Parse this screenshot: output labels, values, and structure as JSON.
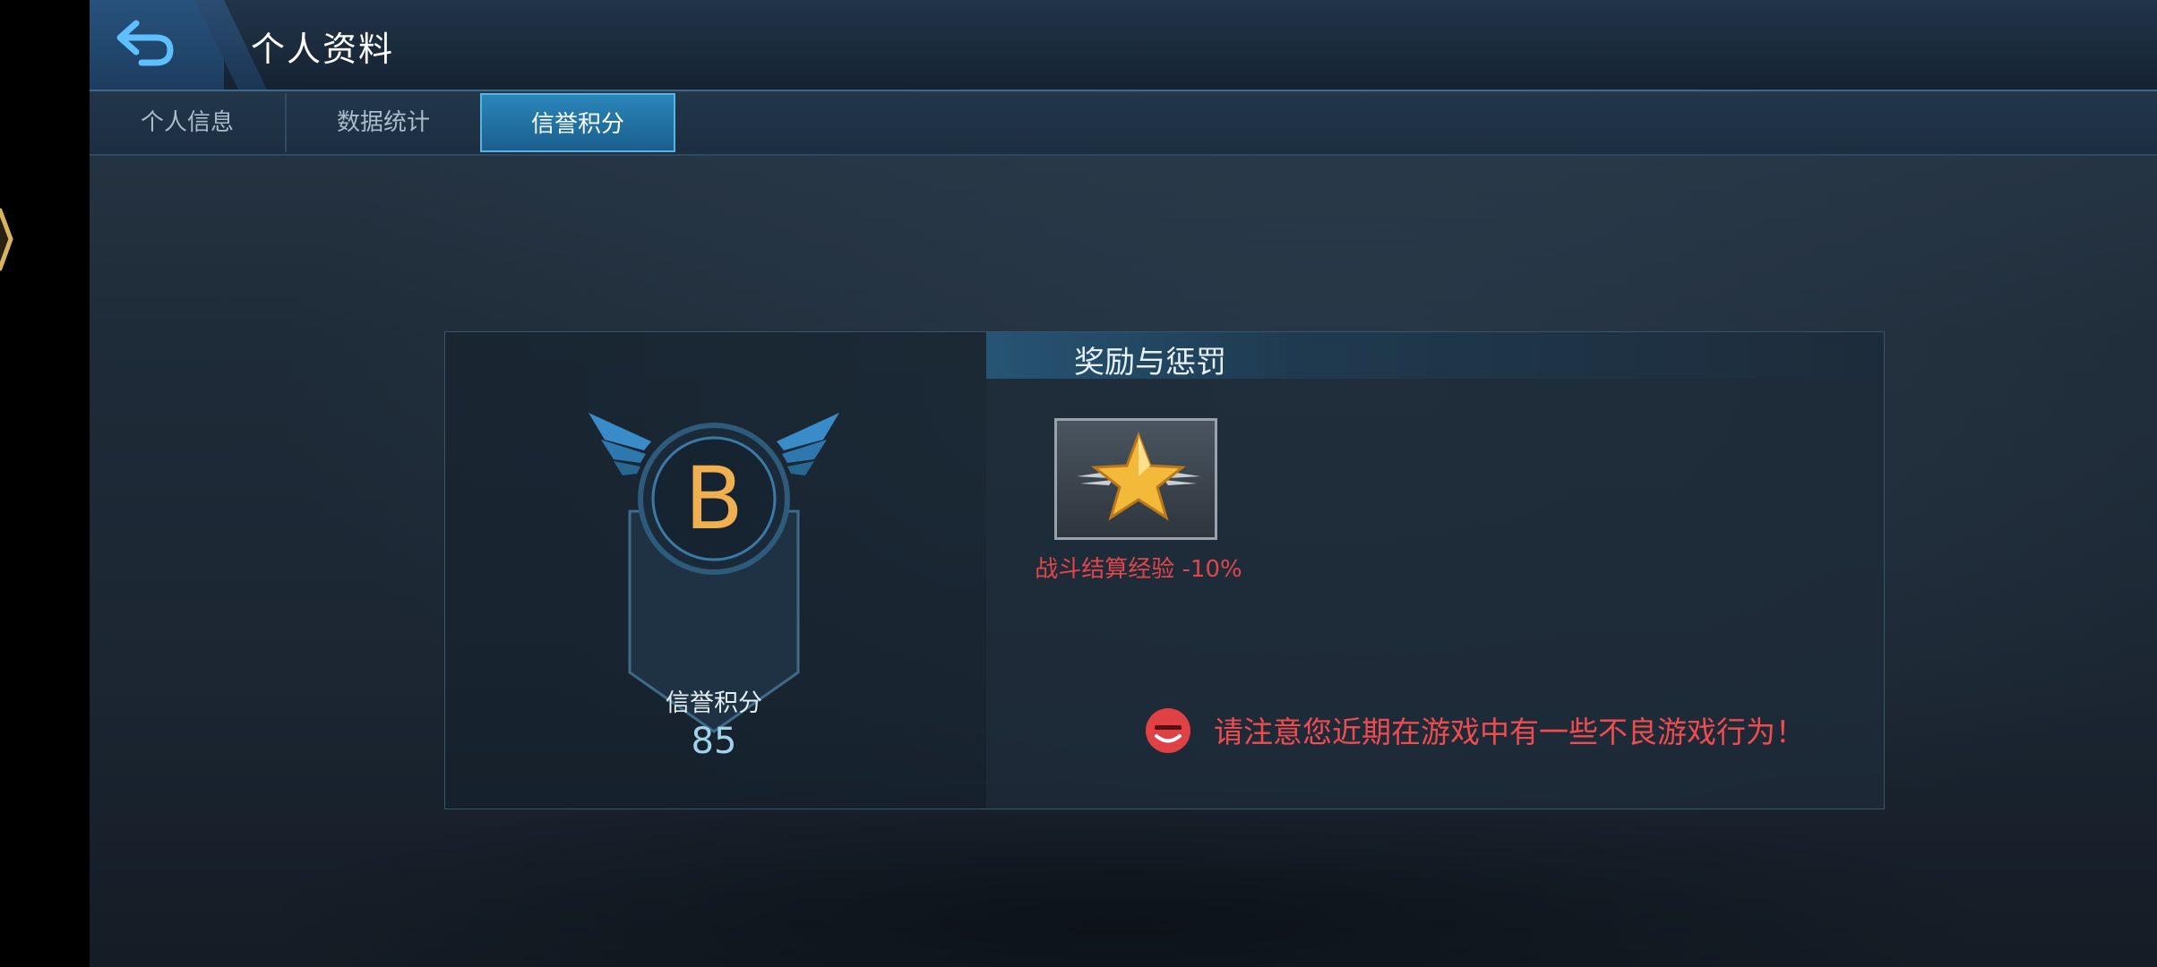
{
  "header": {
    "title": "个人资料",
    "back_icon": "back-arrow-icon"
  },
  "tabs": [
    {
      "label": "个人信息",
      "active": false
    },
    {
      "label": "数据统计",
      "active": false
    },
    {
      "label": "信誉积分",
      "active": true
    }
  ],
  "credit": {
    "grade": "B",
    "label": "信誉积分",
    "score": "85"
  },
  "rewards_section": {
    "title": "奖励与惩罚",
    "item": {
      "icon": "gold-star-icon",
      "caption": "战斗结算经验 -10%"
    },
    "warning": {
      "icon": "red-face-icon",
      "text": "请注意您近期在游戏中有一些不良游戏行为！"
    }
  },
  "colors": {
    "accent": "#2a86b9",
    "grade": "#f0b050",
    "warning": "#ef4c4f"
  }
}
